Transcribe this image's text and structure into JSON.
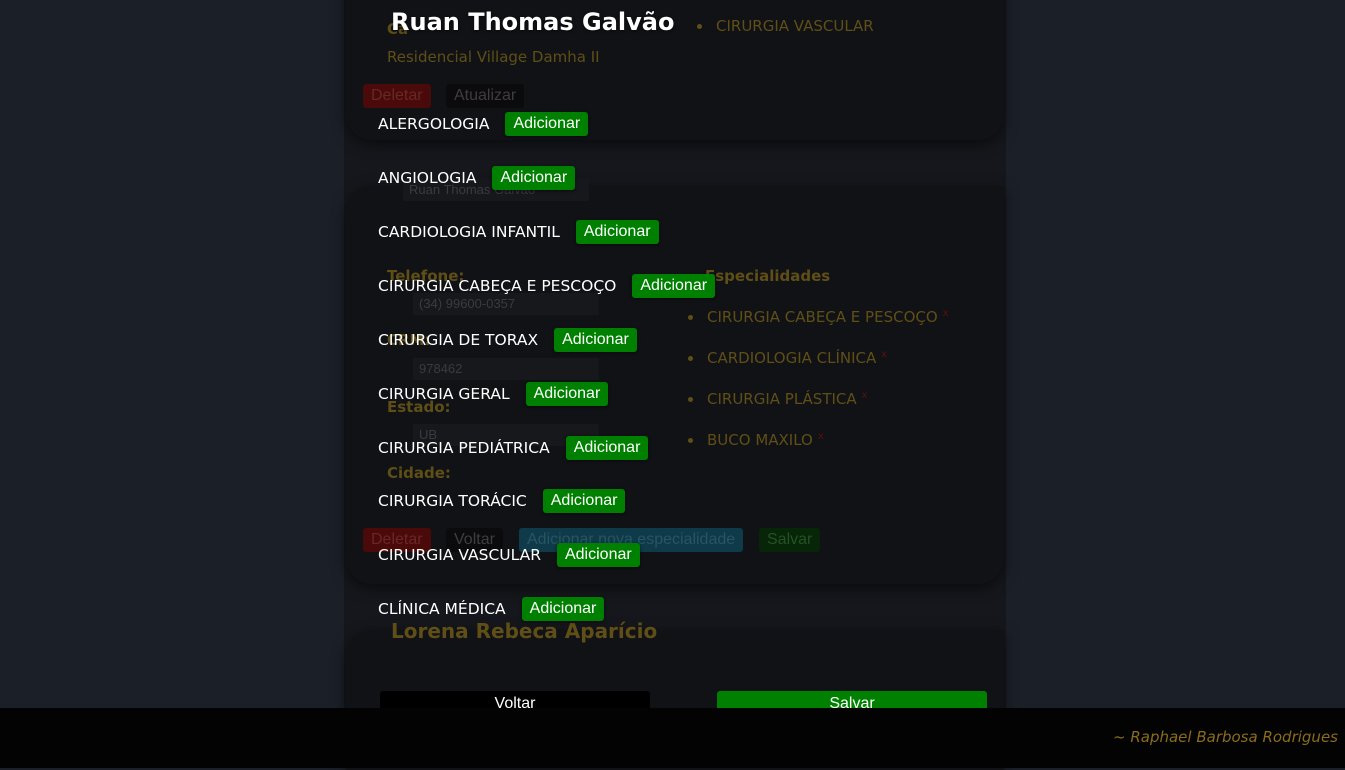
{
  "background": {
    "card1": {
      "label_partial": "Ca",
      "address": "Residencial Village Damha II",
      "top_spec": "CIRURGIA VASCULAR",
      "delete_label": "Deletar",
      "update_label": "Atualizar"
    },
    "card2": {
      "name_input": "Ruan Thomas Galvão",
      "telefone_label": "Telefone:",
      "telefone_value": "(34) 99600-0357",
      "crm_label": "CRM:",
      "crm_value": "978462",
      "estado_label": "Estado:",
      "estado_value": "UB",
      "cidade_label": "Cidade:",
      "especialidades_label": "Especialidades",
      "specialties": [
        "CIRURGIA CABEÇA E PESCOÇO",
        "CARDIOLOGIA CLÍNICA",
        "CIRURGIA PLÁSTICA",
        "BUCO MAXILO"
      ],
      "remove_mark": "x",
      "delete_label": "Deletar",
      "back_label": "Voltar",
      "add_new_label": "Adicionar nova especialidade",
      "save_label": "Salvar"
    },
    "card3": {
      "name": "Lorena Rebeca Aparício"
    }
  },
  "modal": {
    "title": "Ruan Thomas Galvão",
    "add_label": "Adicionar",
    "specialties": [
      "ALERGOLOGIA",
      "ANGIOLOGIA",
      "CARDIOLOGIA INFANTIL",
      "CIRURGIA CABEÇA E PESCOÇO",
      "CIRURGIA DE TORAX",
      "CIRURGIA GERAL",
      "CIRURGIA PEDIÁTRICA",
      "CIRURGIA TORÁCIC",
      "CIRURGIA VASCULAR",
      "CLÍNICA MÉDICA"
    ],
    "back_label": "Voltar",
    "save_label": "Salvar"
  },
  "footer": {
    "credit": "~ Raphael Barbosa Rodrigues"
  },
  "colors": {
    "accent_green": "#008000",
    "gold": "#8a6c1c",
    "danger": "#4a0a0a"
  }
}
